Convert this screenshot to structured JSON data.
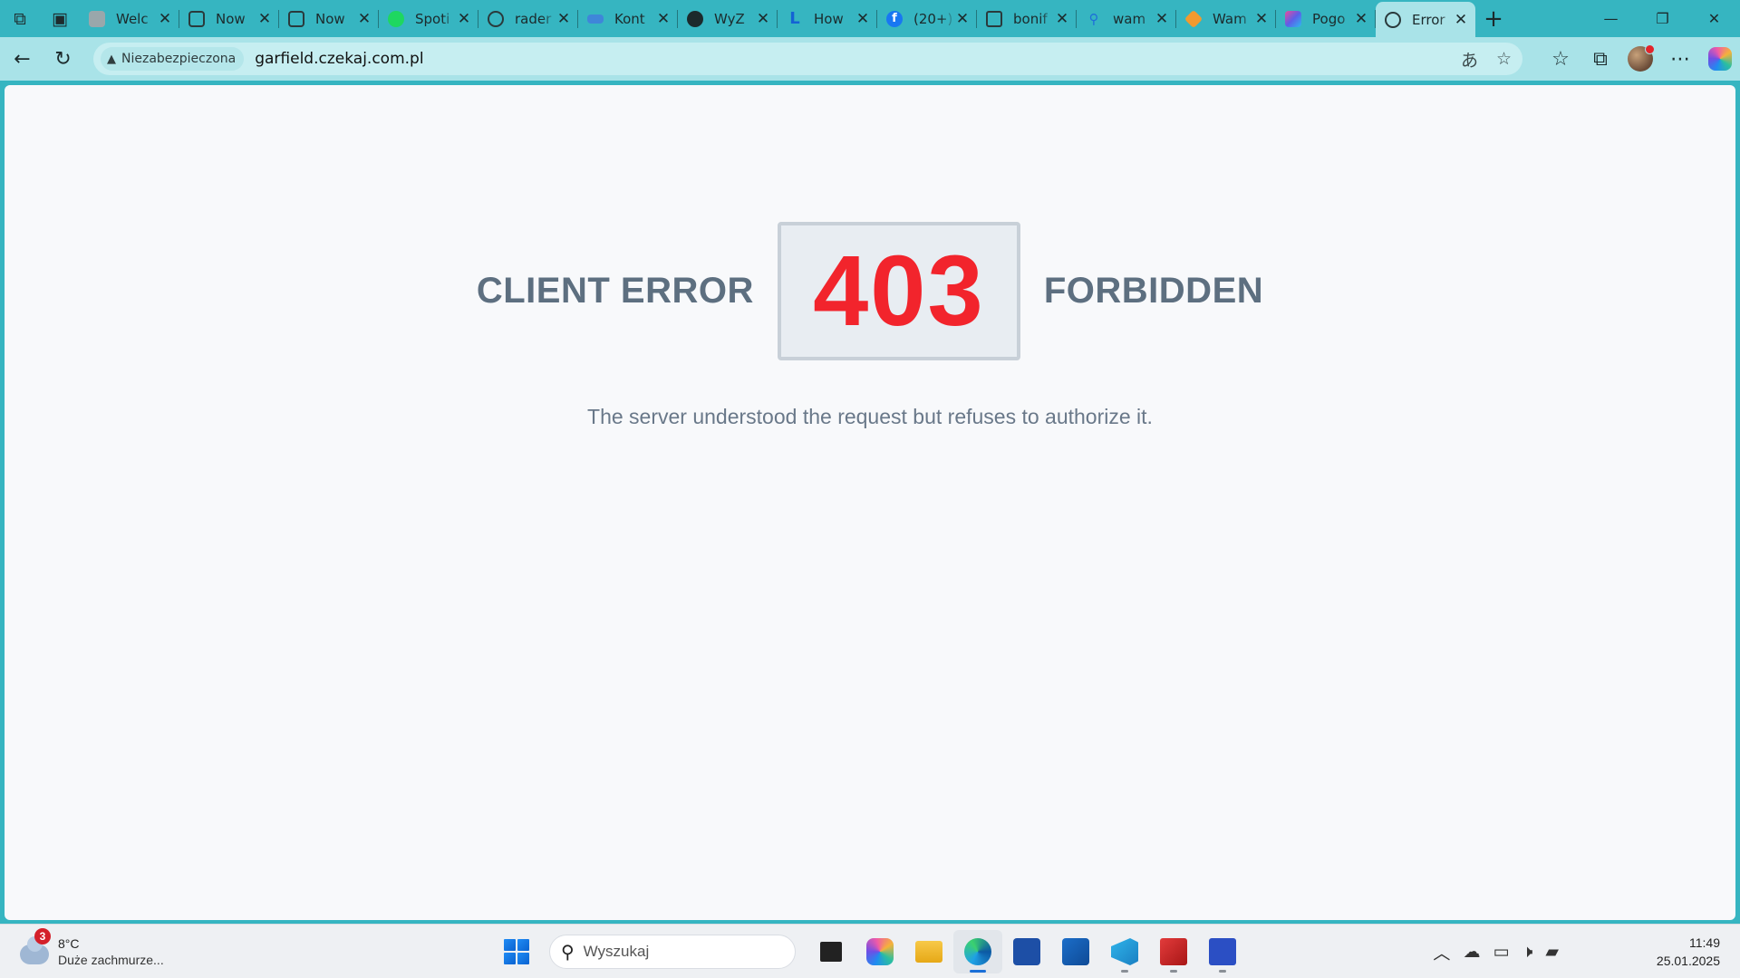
{
  "browser": {
    "tabs": [
      {
        "title": "Welc",
        "favicon": "gray"
      },
      {
        "title": "Now",
        "favicon": "page"
      },
      {
        "title": "Now",
        "favicon": "page"
      },
      {
        "title": "Spoti",
        "favicon": "spotify"
      },
      {
        "title": "rader",
        "favicon": "globe"
      },
      {
        "title": "Kont",
        "favicon": "blue"
      },
      {
        "title": "WyZ",
        "favicon": "github"
      },
      {
        "title": "How",
        "favicon": "blue-L"
      },
      {
        "title": "(20+)",
        "favicon": "facebook"
      },
      {
        "title": "bonif",
        "favicon": "doc"
      },
      {
        "title": "wam",
        "favicon": "search"
      },
      {
        "title": "Wam",
        "favicon": "orange"
      },
      {
        "title": "Pogo",
        "favicon": "colorful"
      },
      {
        "title": "Error",
        "favicon": "globe",
        "active": true
      }
    ],
    "address": {
      "security_label": "Niezabezpieczona",
      "url": "garfield.czekaj.com.pl"
    }
  },
  "page": {
    "left_label": "CLIENT ERROR",
    "code": "403",
    "right_label": "FORBIDDEN",
    "message": "The server understood the request but refuses to authorize it.",
    "colors": {
      "code": "#f2242c",
      "labels": "#5d6f80",
      "message": "#697889"
    }
  },
  "taskbar": {
    "weather": {
      "badge": "3",
      "temp": "8°C",
      "desc": "Duże zachmurze..."
    },
    "search_placeholder": "Wyszukaj",
    "apps": [
      "task-view",
      "copilot",
      "file-explorer",
      "edge",
      "store",
      "outlook",
      "vscode",
      "x64dbg",
      "save-app"
    ],
    "clock": {
      "time": "11:49",
      "date": "25.01.2025"
    }
  }
}
